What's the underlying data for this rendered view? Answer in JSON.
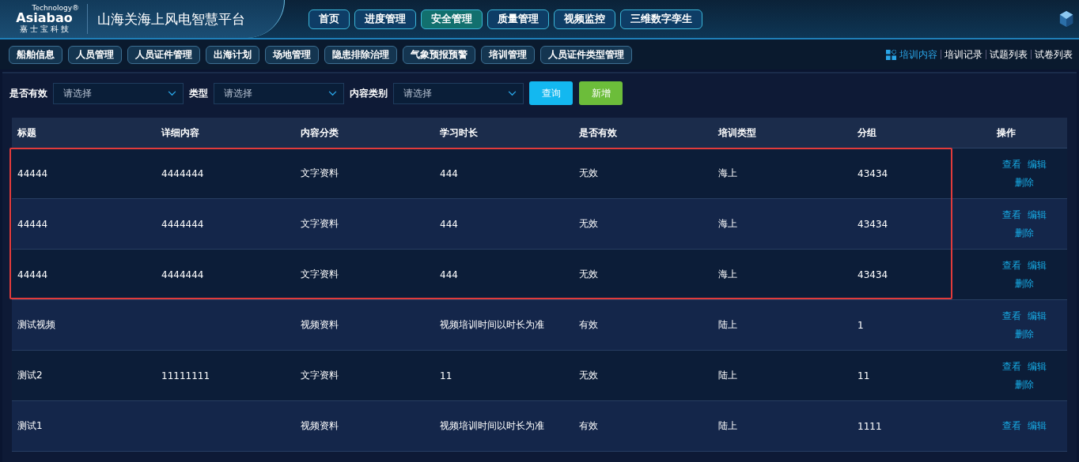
{
  "brand": {
    "logo_text": "Asiabao",
    "logo_tag": "Technology®",
    "logo_sub": "嘉 士 宝 科 技",
    "title": "山海关海上风电智慧平台"
  },
  "main_nav": [
    {
      "label": "首页",
      "selected": false
    },
    {
      "label": "进度管理",
      "selected": false
    },
    {
      "label": "安全管理",
      "selected": true
    },
    {
      "label": "质量管理",
      "selected": false
    },
    {
      "label": "视频监控",
      "selected": false
    },
    {
      "label": "三维数字孪生",
      "selected": false
    }
  ],
  "sub_nav": [
    {
      "label": "船舶信息"
    },
    {
      "label": "人员管理"
    },
    {
      "label": "人员证件管理"
    },
    {
      "label": "出海计划"
    },
    {
      "label": "场地管理"
    },
    {
      "label": "隐患排除治理"
    },
    {
      "label": "气象预报预警"
    },
    {
      "label": "培训管理"
    },
    {
      "label": "人员证件类型管理"
    }
  ],
  "page_tabs": [
    {
      "label": "培训内容",
      "selected": true
    },
    {
      "label": "培训记录",
      "selected": false
    },
    {
      "label": "试题列表",
      "selected": false
    },
    {
      "label": "试卷列表",
      "selected": false
    }
  ],
  "filters": [
    {
      "label": "是否有效",
      "placeholder": "请选择"
    },
    {
      "label": "类型",
      "placeholder": "请选择"
    },
    {
      "label": "内容类别",
      "placeholder": "请选择"
    }
  ],
  "buttons": [
    {
      "label": "查询",
      "kind": "query"
    },
    {
      "label": "新增",
      "kind": "add"
    }
  ],
  "table": {
    "columns": [
      "标题",
      "详细内容",
      "内容分类",
      "学习时长",
      "是否有效",
      "培训类型",
      "分组",
      "操作"
    ],
    "rows": [
      {
        "cells": [
          "44444",
          "4444444",
          "文字资料",
          "444",
          "无效",
          "海上",
          "43434"
        ],
        "highlighted": true,
        "actions": [
          "查看",
          "编辑",
          "删除"
        ]
      },
      {
        "cells": [
          "44444",
          "4444444",
          "文字资料",
          "444",
          "无效",
          "海上",
          "43434"
        ],
        "highlighted": true,
        "actions": [
          "查看",
          "编辑",
          "删除"
        ]
      },
      {
        "cells": [
          "44444",
          "4444444",
          "文字资料",
          "444",
          "无效",
          "海上",
          "43434"
        ],
        "highlighted": true,
        "actions": [
          "查看",
          "编辑",
          "删除"
        ]
      },
      {
        "cells": [
          "测试视频",
          "",
          "视频资料",
          "视频培训时间以时长为准",
          "有效",
          "陆上",
          "1"
        ],
        "highlighted": false,
        "actions": [
          "查看",
          "编辑",
          "删除"
        ]
      },
      {
        "cells": [
          "测试2",
          "11111111",
          "文字资料",
          "11",
          "无效",
          "陆上",
          "11"
        ],
        "highlighted": false,
        "actions": [
          "查看",
          "编辑",
          "删除"
        ]
      },
      {
        "cells": [
          "测试1",
          "",
          "视频资料",
          "视频培训时间以时长为准",
          "有效",
          "陆上",
          "1111"
        ],
        "highlighted": false,
        "actions": [
          "查看",
          "编辑"
        ]
      }
    ]
  }
}
